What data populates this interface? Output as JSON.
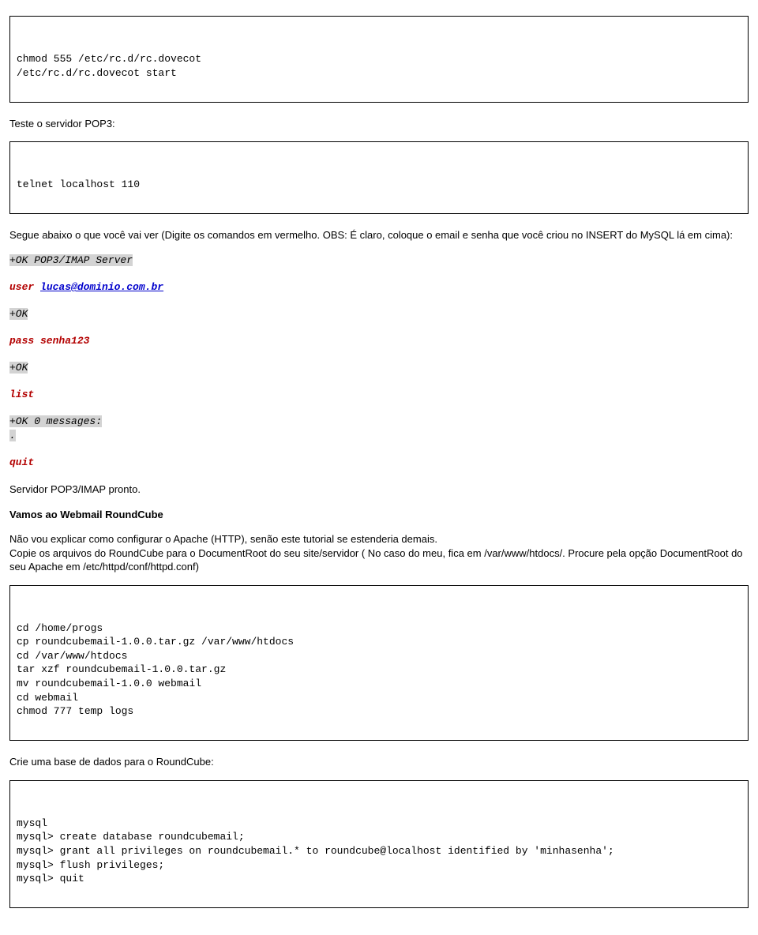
{
  "box1": {
    "lines": [
      "chmod 555 /etc/rc.d/rc.dovecot",
      "/etc/rc.d/rc.dovecot start"
    ]
  },
  "p1": "Teste o servidor POP3:",
  "box2": {
    "lines": [
      "telnet localhost 110"
    ]
  },
  "p2": "Segue abaixo o que você vai ver (Digite os comandos em vermelho. OBS: É claro, coloque o email e senha que você criou no INSERT do MySQL lá em cima):",
  "session": {
    "l1": "+OK POP3/IMAP Server",
    "user_prefix": "user ",
    "user_link": "lucas@dominio.com.br",
    "ok1": "+OK",
    "pass": "pass senha123",
    "ok2": "+OK",
    "list": "list",
    "msgs": "+OK 0 messages:",
    "dot": ".",
    "quit": "quit"
  },
  "p3": "Servidor POP3/IMAP pronto.",
  "h1": "Vamos ao Webmail RoundCube",
  "p4a": "Não vou explicar como configurar o Apache (HTTP), senão este tutorial se estenderia demais.",
  "p4b": "Copie os arquivos do RoundCube para o DocumentRoot do seu site/servidor ( No caso do meu, fica em /var/www/htdocs/. Procure pela opção DocumentRoot do seu Apache em /etc/httpd/conf/httpd.conf)",
  "box3": {
    "lines": [
      "cd /home/progs",
      "cp roundcubemail-1.0.0.tar.gz /var/www/htdocs",
      "cd /var/www/htdocs",
      "tar xzf roundcubemail-1.0.0.tar.gz",
      "mv roundcubemail-1.0.0 webmail",
      "cd webmail",
      "chmod 777 temp logs"
    ]
  },
  "p5": "Crie uma base de dados para o RoundCube:",
  "box4": {
    "lines": [
      "mysql",
      "mysql> create database roundcubemail;",
      "mysql> grant all privileges on roundcubemail.* to roundcube@localhost identified by 'minhasenha';",
      "mysql> flush privileges;",
      "mysql> quit"
    ]
  }
}
